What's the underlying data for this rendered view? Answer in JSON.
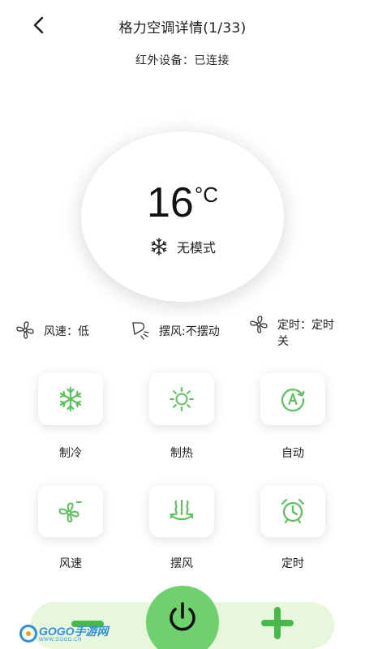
{
  "header": {
    "title": "格力空调详情(1/33)",
    "ir_status": "红外设备：已连接"
  },
  "display": {
    "temperature": "16",
    "unit": "°C",
    "mode_icon": "snowflake-icon",
    "mode_label": "无模式"
  },
  "status": {
    "fan_speed": "风速：低",
    "swing": "摆风:不摆动",
    "timer_line1": "定时：定时",
    "timer_line2": "关"
  },
  "controls": {
    "cool": {
      "label": "制冷",
      "icon": "snowflake-icon"
    },
    "heat": {
      "label": "制热",
      "icon": "sun-icon"
    },
    "auto": {
      "label": "自动",
      "icon": "auto-mode-icon"
    },
    "fan": {
      "label": "风速",
      "icon": "fan-icon"
    },
    "swing": {
      "label": "摆风",
      "icon": "swing-icon"
    },
    "timer": {
      "label": "定时",
      "icon": "alarm-clock-icon"
    }
  },
  "bottom": {
    "minus_icon": "minus-icon",
    "power_icon": "power-icon",
    "plus_icon": "plus-icon"
  },
  "watermark": {
    "brand": "GOGO手游网",
    "url": "WWW.GOGO.CN"
  },
  "colors": {
    "accent": "#49b84c",
    "power_bg": "#6fd16e",
    "bar_bg": "#e7f7dc",
    "icon_green": "#5cc15c"
  }
}
